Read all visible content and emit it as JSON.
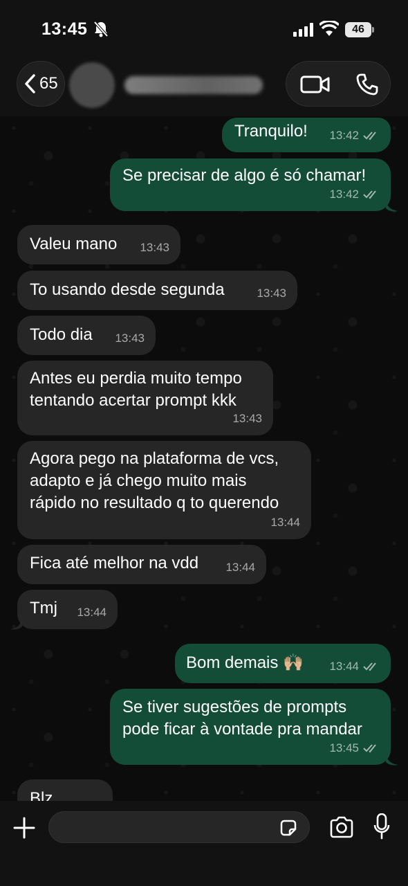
{
  "status_bar": {
    "time": "13:45",
    "battery": "46"
  },
  "header": {
    "back_count": "65"
  },
  "messages": [
    {
      "dir": "out",
      "text": "Tranquilo!",
      "time": "13:42"
    },
    {
      "dir": "out",
      "text": "Se precisar de algo é só chamar!",
      "time": "13:42"
    },
    {
      "dir": "in",
      "text": "Valeu mano",
      "time": "13:43"
    },
    {
      "dir": "in",
      "text": "To usando desde segunda",
      "time": "13:43"
    },
    {
      "dir": "in",
      "text": "Todo dia",
      "time": "13:43"
    },
    {
      "dir": "in",
      "text": "Antes eu perdia muito tempo\ntentando acertar prompt kkk",
      "time": "13:43"
    },
    {
      "dir": "in",
      "text": "Agora pego na plataforma de vcs,\nadapto e já chego muito mais\nrápido no resultado q to querendo",
      "time": "13:44"
    },
    {
      "dir": "in",
      "text": "Fica até melhor na vdd",
      "time": "13:44"
    },
    {
      "dir": "in",
      "text": "Tmj",
      "time": "13:44"
    },
    {
      "dir": "out",
      "text": "Bom demais 🙌🏼",
      "time": "13:44"
    },
    {
      "dir": "out",
      "text": "Se tiver sugestões de prompts\npode ficar à vontade pra mandar",
      "time": "13:45"
    },
    {
      "dir": "in",
      "text": "Blz",
      "time": ""
    }
  ],
  "icons": {
    "back": "chevron-left-icon",
    "video": "video-camera-icon",
    "call": "phone-icon",
    "muted": "bell-slash-icon",
    "plus": "plus-icon",
    "sticker": "sticker-icon",
    "camera": "camera-icon",
    "mic": "microphone-icon"
  },
  "colors": {
    "incoming_bubble": "#262626",
    "outgoing_bubble": "#144d37",
    "background": "#0c0c0c"
  }
}
